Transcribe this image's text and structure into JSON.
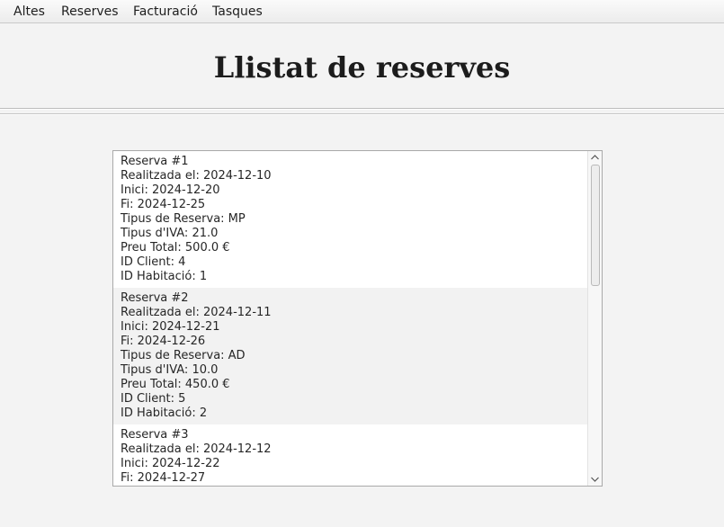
{
  "menu": {
    "items": [
      {
        "label": "Altes"
      },
      {
        "label": "Reserves"
      },
      {
        "label": "Facturació"
      },
      {
        "label": "Tasques"
      }
    ]
  },
  "page": {
    "title": "Llistat de reserves"
  },
  "scrollbar": {
    "up_icon": "chevron-up-icon",
    "down_icon": "chevron-down-icon"
  },
  "reservations": [
    {
      "title": "Reserva #1",
      "made_on": "Realitzada el: 2024-12-10",
      "start": "Inici: 2024-12-20",
      "end": "Fi: 2024-12-25",
      "type": "Tipus de Reserva: MP",
      "vat": "Tipus d'IVA: 21.0",
      "total": "Preu Total: 500.0 €",
      "client": "ID Client: 4",
      "room": "ID Habitació: 1"
    },
    {
      "title": "Reserva #2",
      "made_on": "Realitzada el: 2024-12-11",
      "start": "Inici: 2024-12-21",
      "end": "Fi: 2024-12-26",
      "type": "Tipus de Reserva: AD",
      "vat": "Tipus d'IVA: 10.0",
      "total": "Preu Total: 450.0 €",
      "client": "ID Client: 5",
      "room": "ID Habitació: 2"
    },
    {
      "title": "Reserva #3",
      "made_on": "Realitzada el: 2024-12-12",
      "start": "Inici: 2024-12-22",
      "end": "Fi: 2024-12-27"
    }
  ]
}
